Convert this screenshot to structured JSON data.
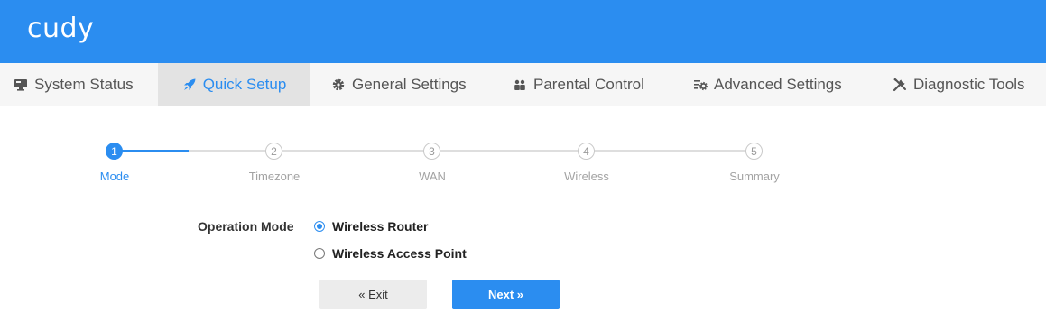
{
  "brand": {
    "logo_text": "cudy",
    "header_color": "#2b8df0",
    "accent_color": "#2b8df0"
  },
  "nav": {
    "tabs": [
      {
        "label": "System Status",
        "icon": "monitor-icon",
        "active": false
      },
      {
        "label": "Quick Setup",
        "icon": "rocket-icon",
        "active": true
      },
      {
        "label": "General Settings",
        "icon": "gear-icon",
        "active": false
      },
      {
        "label": "Parental Control",
        "icon": "users-icon",
        "active": false
      },
      {
        "label": "Advanced Settings",
        "icon": "sliders-gear-icon",
        "active": false
      },
      {
        "label": "Diagnostic Tools",
        "icon": "tools-icon",
        "active": false
      }
    ]
  },
  "stepper": {
    "current_step": 1,
    "steps": [
      {
        "number": "1",
        "label": "Mode"
      },
      {
        "number": "2",
        "label": "Timezone"
      },
      {
        "number": "3",
        "label": "WAN"
      },
      {
        "number": "4",
        "label": "Wireless"
      },
      {
        "number": "5",
        "label": "Summary"
      }
    ]
  },
  "form": {
    "operation_mode_label": "Operation Mode",
    "options": [
      {
        "label": "Wireless Router",
        "checked": true
      },
      {
        "label": "Wireless Access Point",
        "checked": false
      }
    ]
  },
  "actions": {
    "exit_label": "« Exit",
    "next_label": "Next »"
  }
}
